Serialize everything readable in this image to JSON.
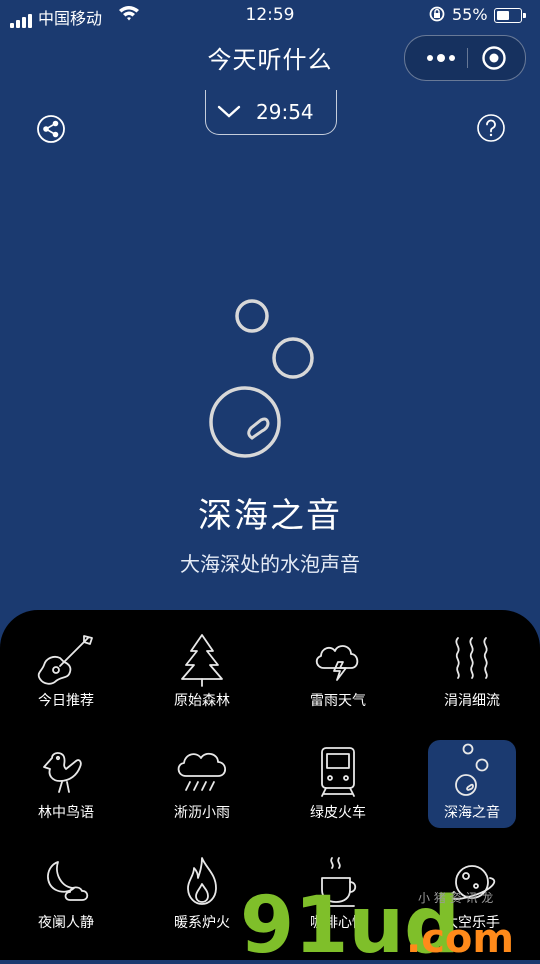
{
  "status_bar": {
    "carrier": "中国移动",
    "time": "12:59",
    "battery": "55%",
    "battery_level": 0.55
  },
  "header": {
    "title": "今天听什么"
  },
  "timer": {
    "value": "29:54"
  },
  "current": {
    "title": "深海之音",
    "subtitle": "大海深处的水泡声音"
  },
  "categories": [
    {
      "label": "今日推荐",
      "icon": "guitar-icon",
      "active": false
    },
    {
      "label": "原始森林",
      "icon": "pine-tree-icon",
      "active": false
    },
    {
      "label": "雷雨天气",
      "icon": "thunderstorm-icon",
      "active": false
    },
    {
      "label": "涓涓细流",
      "icon": "stream-icon",
      "active": false
    },
    {
      "label": "林中鸟语",
      "icon": "bird-icon",
      "active": false
    },
    {
      "label": "淅沥小雨",
      "icon": "rain-cloud-icon",
      "active": false
    },
    {
      "label": "绿皮火车",
      "icon": "train-icon",
      "active": false
    },
    {
      "label": "深海之音",
      "icon": "bubbles-icon",
      "active": true
    },
    {
      "label": "夜阑人静",
      "icon": "moon-cloud-icon",
      "active": false
    },
    {
      "label": "暖系炉火",
      "icon": "flame-icon",
      "active": false
    },
    {
      "label": "咖啡心情",
      "icon": "coffee-cup-icon",
      "active": false
    },
    {
      "label": "太空乐手",
      "icon": "planet-icon",
      "active": false
    }
  ],
  "watermark": {
    "text": "91ud.com",
    "small": "小 猪 资 讯 龙"
  },
  "colors": {
    "background": "#1b3a70",
    "panel": "#000000",
    "active_cell": "#1b3a70",
    "watermark_green": "#7fbf2a",
    "watermark_orange": "#ff8a1a"
  }
}
